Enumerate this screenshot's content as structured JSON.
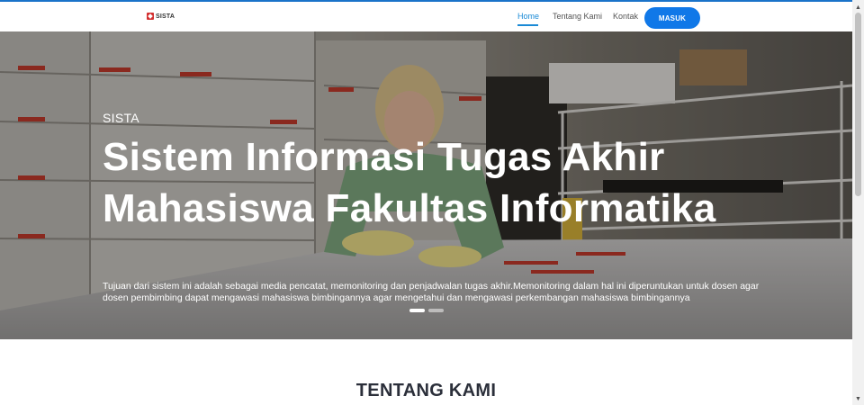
{
  "brand": {
    "name": "SISTA",
    "color": "#d32f2f"
  },
  "nav": {
    "items": [
      {
        "label": "Home",
        "active": true
      },
      {
        "label": "Tentang Kami",
        "active": false
      },
      {
        "label": "Kontak",
        "active": false
      }
    ],
    "login_label": "MASUK",
    "accent": "#1078e8"
  },
  "hero": {
    "kicker": "SISTA",
    "title": "Sistem Informasi Tugas Akhir Mahasiswa Fakultas Informatika",
    "description": "Tujuan dari sistem ini adalah sebagai media pencatat, memonitoring dan penjadwalan tugas akhir.Memonitoring dalam hal ini diperuntukan untuk dosen agar dosen pembimbing dapat mengawasi mahasiswa bimbingannya agar mengetahui dan mengawasi perkembangan mahasiswa bimbingannya",
    "slides": [
      {
        "active": true
      },
      {
        "active": false
      }
    ]
  },
  "about": {
    "title": "TENTANG KAMI"
  },
  "icons": {
    "scroll_up": "arrow-up-icon",
    "scroll_down": "arrow-down-icon"
  }
}
